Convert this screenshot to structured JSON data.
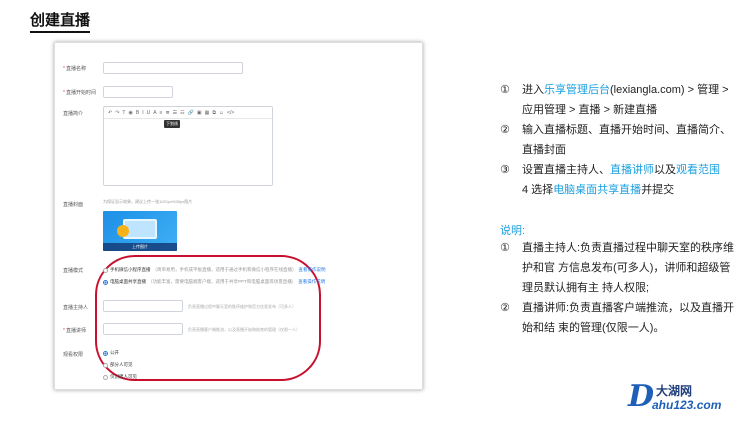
{
  "page_title": "创建直播",
  "form": {
    "name_label": "直播名称",
    "start_label": "直播开始时间",
    "intro_label": "直播简介",
    "toolbar_glyphs": [
      "↶",
      "↷",
      "T",
      "◉",
      "B",
      "I",
      "U",
      "A",
      "≡",
      "≣",
      "☰",
      "☷",
      "🔗",
      "▣",
      "▦",
      "⧉",
      "☺",
      "</>"
    ],
    "tooltip": "下划线",
    "cover_label": "直播封面",
    "cover_hint": "为保证显示效果，建议上传一张1120px*630px图片",
    "cover_upload": "上传图片",
    "mode_label": "直播模式",
    "mode_options": [
      {
        "label": "手机微信小程序直播",
        "note": "（简单易用，手机或平板直播，适用于通过手机和微信小程序在线直播）",
        "link": "查看操作说明"
      },
      {
        "label": "电脑桌面共享直播",
        "note": "（功能丰富，需要电脑端客户端，适用于共享PPT和电脑桌面等场景直播）",
        "link": "查看操作说明"
      }
    ],
    "host_label": "直播主持人",
    "host_hint": "负责直播过程中聊天室的秩序维护和官方信息发布（可多人）",
    "lecturer_label": "直播讲师",
    "lecturer_hint": "负责直播客户端推流，以及直播开始和结束的管理（仅限一人）",
    "scope_label": "观看权限",
    "scope_options": [
      "公开",
      "部分人可见",
      "仅创建人可见"
    ]
  },
  "steps": [
    {
      "num": "①",
      "parts": [
        {
          "t": "进入"
        },
        {
          "t": "乐享管理后台",
          "hl": true
        },
        {
          "t": "(lexiangla.com) > 管理 > 应用管理 > 直播 > 新建直播"
        }
      ]
    },
    {
      "num": "②",
      "parts": [
        {
          "t": "输入直播标题、直播开始时间、直播简介、直播封面"
        }
      ]
    },
    {
      "num": "③",
      "parts": [
        {
          "t": "设置直播主持人、"
        },
        {
          "t": "直播讲师",
          "hl": true
        },
        {
          "t": "以及"
        },
        {
          "t": "观看范围",
          "hl": true
        }
      ]
    }
  ],
  "step4": {
    "pre": "4 选择",
    "hl": "电脑桌面共享直播",
    "post": "并提交"
  },
  "note_title": "说明:",
  "notes": [
    {
      "num": "①",
      "text": "直播主持人:负责直播过程中聊天室的秩序维护和官 方信息发布(可多人)，讲师和超级管理员默认拥有主 持人权限;"
    },
    {
      "num": "②",
      "text": "直播讲师:负责直播客户端推流，以及直播开始和结 束的管理(仅限一人)。"
    }
  ],
  "logo": {
    "mark": "D",
    "cn": "大湖网",
    "url": "ahu123.com"
  },
  "colors": {
    "accent": "#1a9fe0",
    "oval": "#c8102e"
  }
}
